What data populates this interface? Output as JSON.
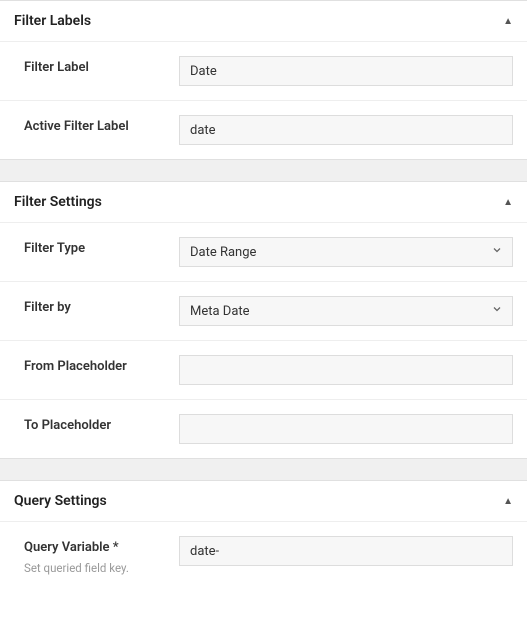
{
  "sections": {
    "filter_labels": {
      "title": "Filter Labels",
      "fields": {
        "filter_label": {
          "label": "Filter Label",
          "value": "Date"
        },
        "active_filter_label": {
          "label": "Active Filter Label",
          "value": "date"
        }
      }
    },
    "filter_settings": {
      "title": "Filter Settings",
      "fields": {
        "filter_type": {
          "label": "Filter Type",
          "value": "Date Range"
        },
        "filter_by": {
          "label": "Filter by",
          "value": "Meta Date"
        },
        "from_placeholder": {
          "label": "From Placeholder",
          "value": ""
        },
        "to_placeholder": {
          "label": "To Placeholder",
          "value": ""
        }
      }
    },
    "query_settings": {
      "title": "Query Settings",
      "fields": {
        "query_variable": {
          "label": "Query Variable *",
          "help": "Set queried field key.",
          "value": "date-"
        }
      }
    }
  }
}
